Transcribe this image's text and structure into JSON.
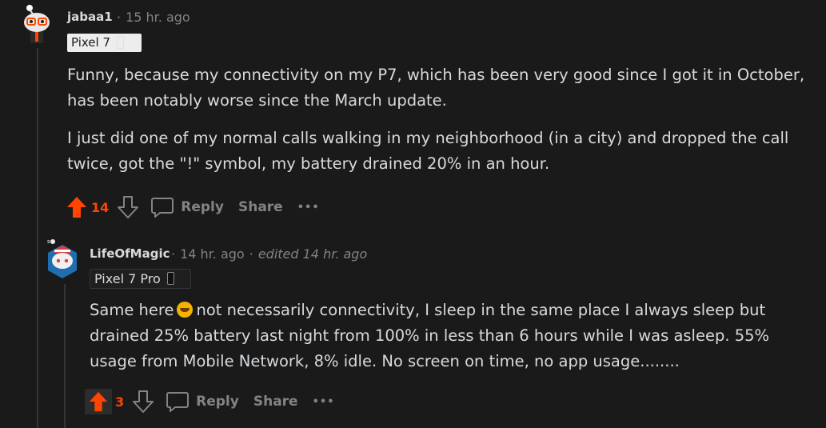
{
  "comment1": {
    "username": "jabaa1",
    "time": "15 hr. ago",
    "flair": "Pixel 7",
    "paragraphs": [
      "Funny, because my connectivity on my P7, which has been very good since I got it in October, has been notably worse since the March update.",
      "I just did one of my normal calls walking in my neighborhood (in a city) and dropped the call twice, got the \"!\" symbol, my battery drained 20% in an hour."
    ],
    "score": "14",
    "reply_label": "Reply",
    "share_label": "Share",
    "more_label": "•••"
  },
  "comment2": {
    "username": "LifeOfMagic",
    "time": "14 hr. ago",
    "edited": "edited 14 hr. ago",
    "flair": "Pixel 7 Pro",
    "text_before_emoji": "Same here",
    "text_after_emoji": "not necessarily connectivity, I sleep in the same place I always sleep but drained 25% battery last night from 100% in less than 6 hours while I was asleep. 55% usage from Mobile Network, 8% idle. No screen on time, no app usage........",
    "score": "3",
    "reply_label": "Reply",
    "share_label": "Share",
    "more_label": "•••"
  },
  "colors": {
    "background": "#1a1a1b",
    "text": "#d7dadc",
    "muted": "#818384",
    "upvote": "#ff4500"
  }
}
